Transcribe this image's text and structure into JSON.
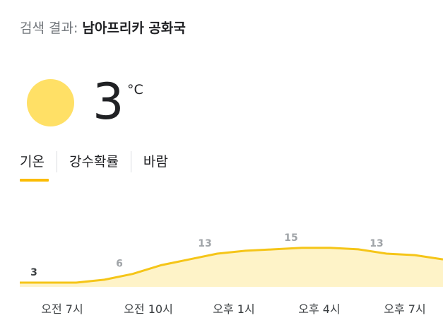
{
  "header": {
    "prefix": "검색 결과: ",
    "query": "남아프리카 공화국"
  },
  "current": {
    "icon": "sun-icon",
    "temperature": "3",
    "unit": "°C"
  },
  "tabs": [
    {
      "label": "기온",
      "selected": true
    },
    {
      "label": "강수확률",
      "selected": false
    },
    {
      "label": "바람",
      "selected": false
    }
  ],
  "colors": {
    "accent": "#fbbc04",
    "line": "#f5c518",
    "fill": "#fef3c8",
    "sun": "#ffe066"
  },
  "chart_data": {
    "type": "area",
    "x": [
      "오전 7시",
      "오전 10시",
      "오후 1시",
      "오후 4시",
      "오후 7시"
    ],
    "labeled_points": [
      {
        "label": "3",
        "value": 3
      },
      {
        "label": "6",
        "value": 6
      },
      {
        "label": "13",
        "value": 13
      },
      {
        "label": "15",
        "value": 15
      },
      {
        "label": "13",
        "value": 13
      }
    ],
    "series": [
      {
        "values": [
          3,
          3,
          3,
          4,
          6,
          9,
          11,
          13,
          14,
          14.5,
          15,
          15,
          14.5,
          13,
          12.5,
          11
        ]
      }
    ]
  }
}
